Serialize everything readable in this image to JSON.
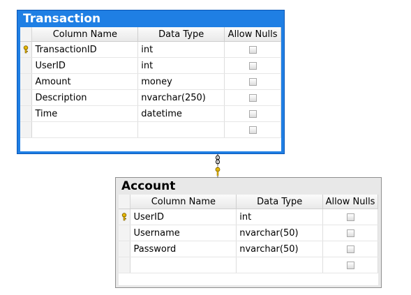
{
  "tables": {
    "transaction": {
      "title": "Transaction",
      "headers": {
        "column": "Column Name",
        "type": "Data Type",
        "nulls": "Allow Nulls"
      },
      "rows": [
        {
          "name": "TransactionID",
          "type": "int",
          "key": true
        },
        {
          "name": "UserID",
          "type": "int",
          "key": false
        },
        {
          "name": "Amount",
          "type": "money",
          "key": false
        },
        {
          "name": "Description",
          "type": "nvarchar(250)",
          "key": false
        },
        {
          "name": "Time",
          "type": "datetime",
          "key": false
        },
        {
          "name": "",
          "type": "",
          "key": false
        }
      ]
    },
    "account": {
      "title": "Account",
      "headers": {
        "column": "Column Name",
        "type": "Data Type",
        "nulls": "Allow Nulls"
      },
      "rows": [
        {
          "name": "UserID",
          "type": "int",
          "key": true
        },
        {
          "name": "Username",
          "type": "nvarchar(50)",
          "key": false
        },
        {
          "name": "Password",
          "type": "nvarchar(50)",
          "key": false
        },
        {
          "name": "",
          "type": "",
          "key": false
        }
      ]
    }
  },
  "relationship": {
    "from": "Transaction",
    "to": "Account"
  },
  "colors": {
    "selected_border": "#1f7fe4",
    "key_icon": "#e6b800"
  }
}
